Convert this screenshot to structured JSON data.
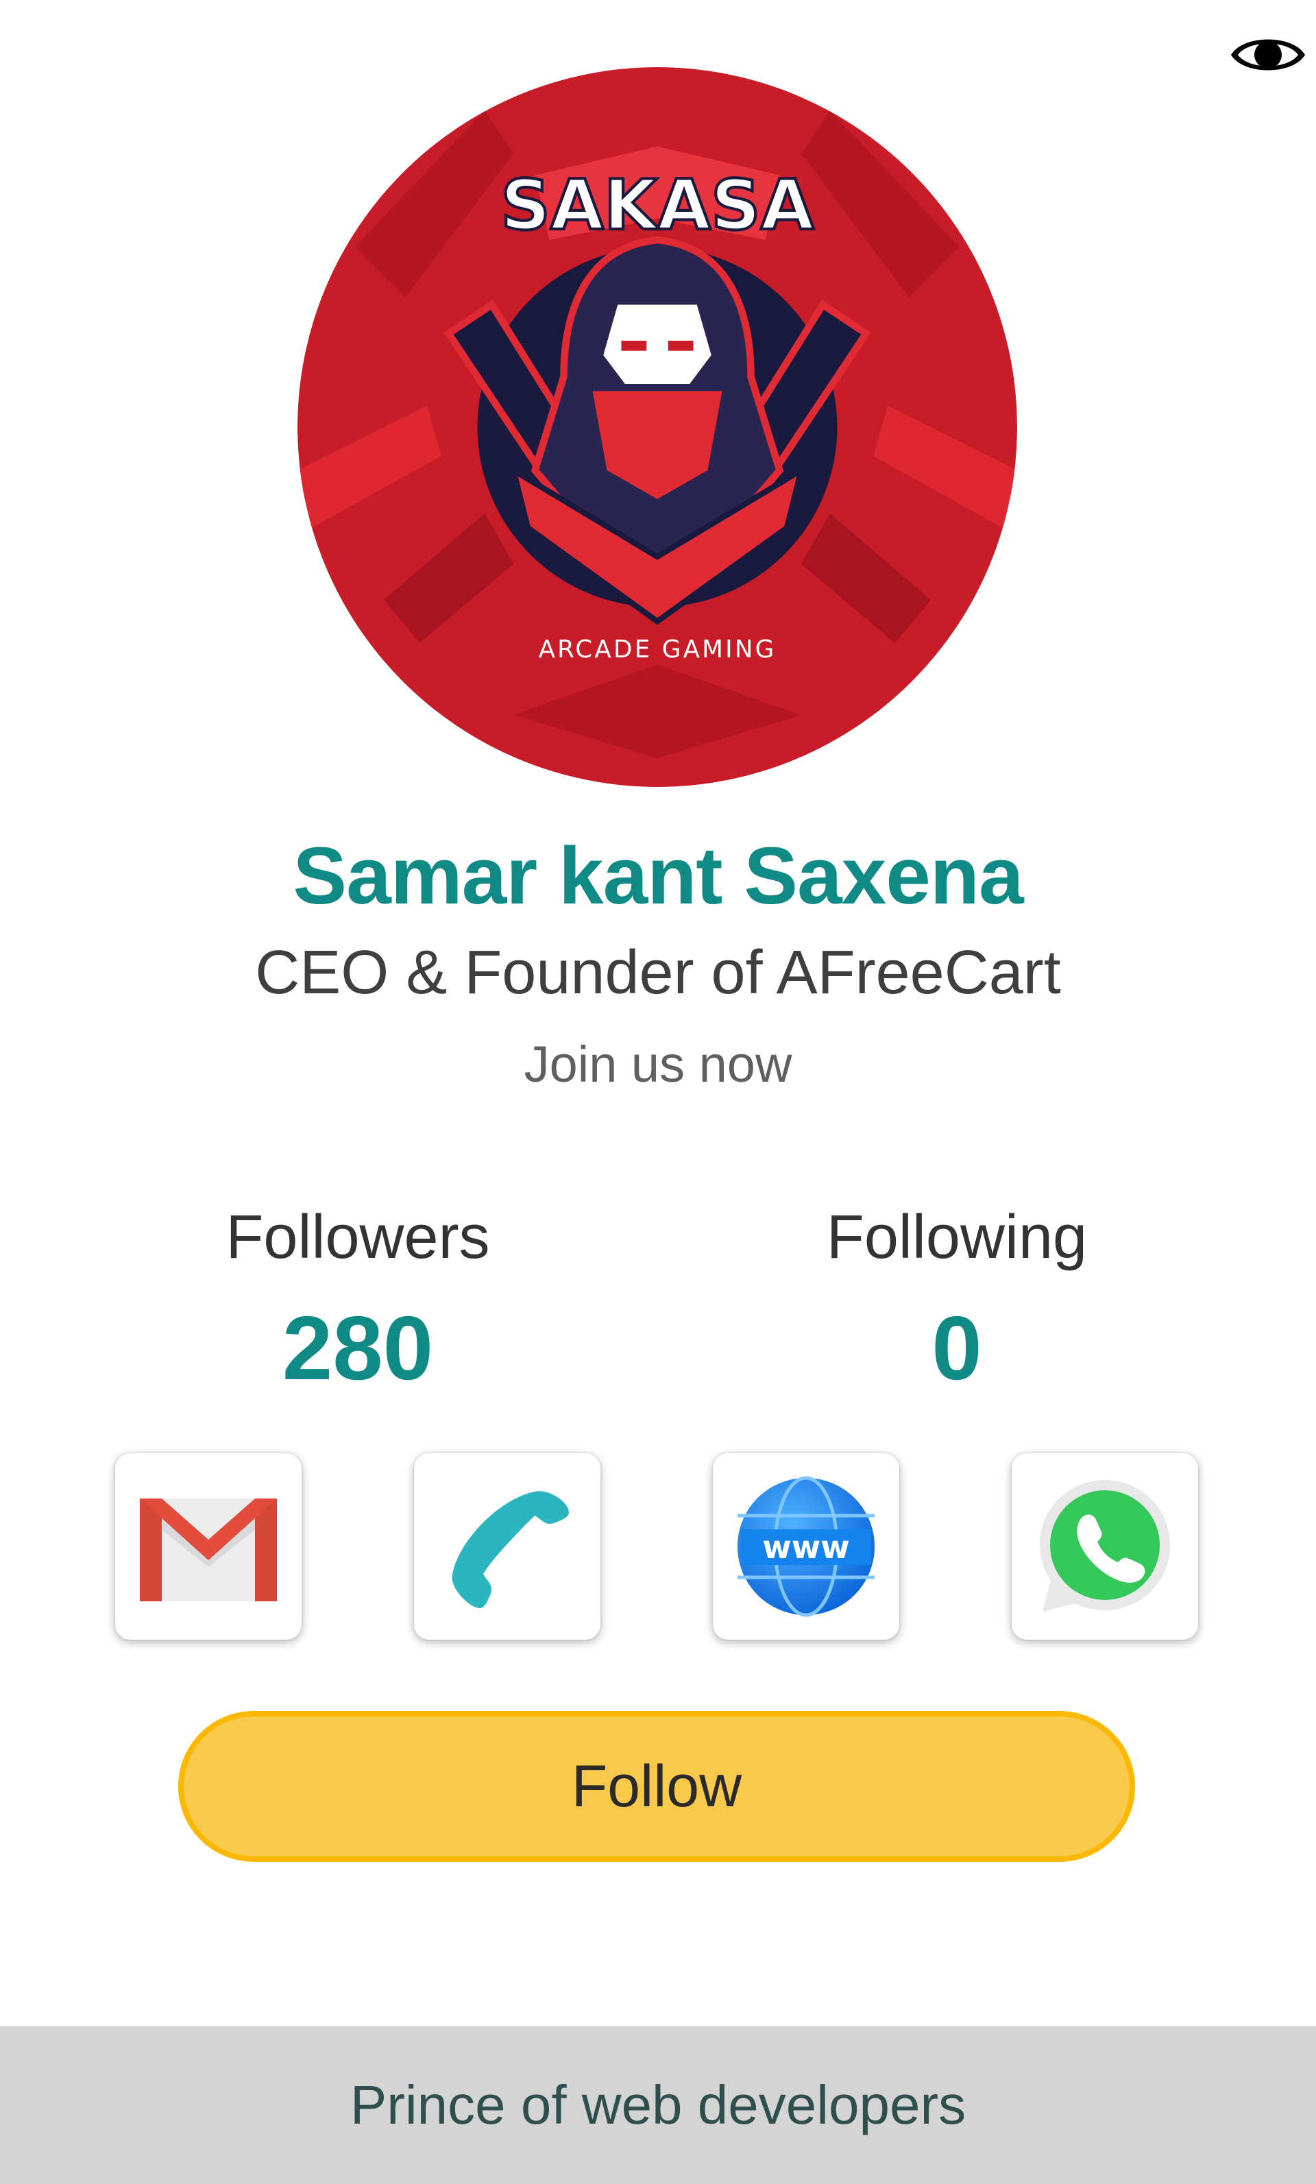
{
  "header": {
    "visibility_icon": "eye-icon"
  },
  "avatar": {
    "logo_top_text": "SAKASA",
    "logo_bottom_text": "ARCADE GAMING"
  },
  "profile": {
    "name": "Samar kant Saxena",
    "title": "CEO & Founder of AFreeCart",
    "tagline": "Join us now"
  },
  "stats": {
    "followers_label": "Followers",
    "followers_value": "280",
    "following_label": "Following",
    "following_value": "0"
  },
  "contacts": [
    {
      "icon": "gmail-icon"
    },
    {
      "icon": "phone-icon"
    },
    {
      "icon": "website-icon",
      "text": "www"
    },
    {
      "icon": "whatsapp-icon"
    }
  ],
  "actions": {
    "follow_label": "Follow"
  },
  "footer": {
    "text": "Prince of web developers"
  },
  "colors": {
    "accent": "#0f8a85",
    "follow_bg": "#f9c94c",
    "follow_border": "#fbb800",
    "footer_bg": "#d4d4d4"
  }
}
